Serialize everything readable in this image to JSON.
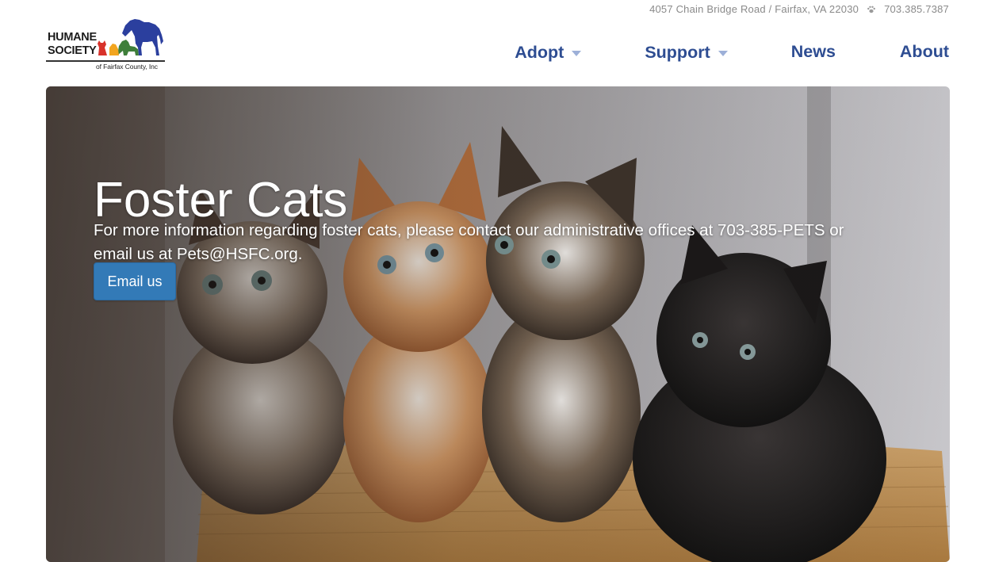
{
  "utility": {
    "address": "4057 Chain Bridge Road / Fairfax, VA 22030",
    "phone": "703.385.7387",
    "paw_icon": "paw-icon"
  },
  "logo": {
    "line1": "HUMANE",
    "line2": "SOCIETY",
    "line3": "of Fairfax County, Inc",
    "colors": {
      "horse": "#2b3f9e",
      "cat": "#d8322b",
      "small_pet": "#f2a51f",
      "dog": "#3f7f3a"
    }
  },
  "nav": {
    "items": [
      {
        "label": "Adopt",
        "has_dropdown": true
      },
      {
        "label": "Support",
        "has_dropdown": true
      },
      {
        "label": "News",
        "has_dropdown": false
      },
      {
        "label": "About",
        "has_dropdown": false
      }
    ],
    "color": "#2e4d92"
  },
  "hero": {
    "title": "Foster Cats",
    "text": "For more information regarding foster cats, please contact our administrative offices at 703-385-PETS or email us at Pets@HSFC.org.",
    "button_label": "Email us",
    "button_color": "#337ab7",
    "image": "kittens-in-basket-photo"
  }
}
